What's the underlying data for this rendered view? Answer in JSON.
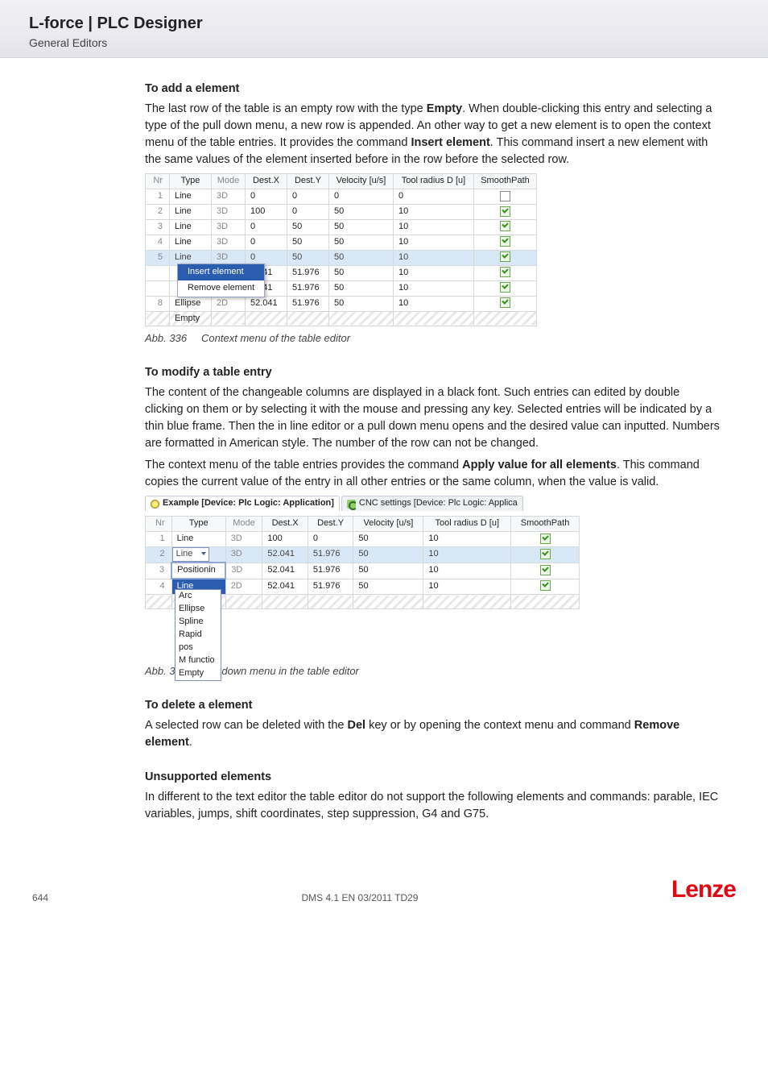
{
  "header": {
    "title": "L-force | PLC Designer",
    "subtitle": "General Editors"
  },
  "sec1": {
    "heading_prefix": "To add",
    "heading_rest": " a element",
    "p1a": "The last row of the table is an empty row with the type ",
    "p1b": "Empty",
    "p1c": ". When double-clicking this entry and selecting a type of the pull down menu, a new row is appended. An other way to get a new element is to open the context menu of the table entries. It provides the command ",
    "p1d": "Insert element",
    "p1e": ". This command insert a new element with the same values of the element inserted before in the row before the selected row."
  },
  "table1": {
    "cols": {
      "nr": "Nr",
      "type": "Type",
      "mode": "Mode",
      "dx": "Dest.X",
      "dy": "Dest.Y",
      "vel": "Velocity [u/s]",
      "tool": "Tool radius D [u]",
      "sp": "SmoothPath"
    },
    "rows": [
      {
        "nr": "1",
        "type": "Line",
        "mode": "3D",
        "dx": "0",
        "dy": "0",
        "vel": "0",
        "tool": "0",
        "sp": "empty"
      },
      {
        "nr": "2",
        "type": "Line",
        "mode": "3D",
        "dx": "100",
        "dy": "0",
        "vel": "50",
        "tool": "10",
        "sp": "checked"
      },
      {
        "nr": "3",
        "type": "Line",
        "mode": "3D",
        "dx": "0",
        "dy": "50",
        "vel": "50",
        "tool": "10",
        "sp": "checked"
      },
      {
        "nr": "4",
        "type": "Line",
        "mode": "3D",
        "dx": "0",
        "dy": "50",
        "vel": "50",
        "tool": "10",
        "sp": "checked"
      },
      {
        "nr": "5",
        "type": "Line",
        "mode": "3D",
        "dx": "0",
        "dy": "50",
        "vel": "50",
        "tool": "10",
        "sp": "checked",
        "selected": true
      },
      {
        "nr": "",
        "type": "",
        "mode": "",
        "dx": "2.041",
        "dy": "51.976",
        "vel": "50",
        "tool": "10",
        "sp": "checked"
      },
      {
        "nr": "",
        "type": "",
        "mode": "",
        "dx": "2.041",
        "dy": "51.976",
        "vel": "50",
        "tool": "10",
        "sp": "checked"
      },
      {
        "nr": "8",
        "type": "Ellipse",
        "mode": "2D",
        "dx": "52.041",
        "dy": "51.976",
        "vel": "50",
        "tool": "10",
        "sp": "checked"
      },
      {
        "nr": "",
        "type": "Empty",
        "mode": "",
        "dx": "",
        "dy": "",
        "vel": "",
        "tool": "",
        "sp": "",
        "hatched": true
      }
    ],
    "ctx": {
      "insert": "Insert element",
      "remove": "Remove element"
    }
  },
  "cap1": {
    "abb": "Abb. 336",
    "text": "Context menu of the table editor"
  },
  "sec2": {
    "heading": "To modify a table entry",
    "p1": "The content of the changeable columns are displayed in a black font. Such entries can edited by double clicking on them or by selecting it with the mouse and pressing any key.  Selected entries will be indicated by a thin blue frame. Then the in line editor or a pull down menu opens and the desired value can inputted. Numbers are formatted in American style. The number of the row can not be changed.",
    "p2a": "The context menu of the table entries provides the command ",
    "p2b": "Apply value for all elements",
    "p2c": ". This command copies the current value of the entry in all other entries or the same column, when the value is valid."
  },
  "tabs": {
    "left": "Example [Device: Plc Logic: Application]",
    "right": "CNC settings [Device: Plc Logic: Applica"
  },
  "table2": {
    "cols": {
      "nr": "Nr",
      "type": "Type",
      "mode": "Mode",
      "dx": "Dest.X",
      "dy": "Dest.Y",
      "vel": "Velocity [u/s]",
      "tool": "Tool radius D [u]",
      "sp": "SmoothPath"
    },
    "rows": [
      {
        "nr": "1",
        "type": "Line",
        "mode": "3D",
        "dx": "100",
        "dy": "0",
        "vel": "50",
        "tool": "10",
        "sp": "checked"
      },
      {
        "nr": "2",
        "type_dd": "Line",
        "mode": "3D",
        "dx": "52.041",
        "dy": "51.976",
        "vel": "50",
        "tool": "10",
        "sp": "checked",
        "selected_row": true
      },
      {
        "nr": "3",
        "type_sel": "Positionin",
        "mode": "3D",
        "dx": "52.041",
        "dy": "51.976",
        "vel": "50",
        "tool": "10",
        "sp": "checked"
      },
      {
        "nr": "4",
        "type_hl": "Line",
        "mode": "2D",
        "dx": "52.041",
        "dy": "51.976",
        "vel": "50",
        "tool": "10",
        "sp": "checked"
      },
      {
        "nr": "",
        "type": "",
        "mode": "",
        "dx": "",
        "dy": "",
        "vel": "",
        "tool": "",
        "sp": "",
        "hatched": true
      }
    ],
    "dropdown": [
      "Arc",
      "Ellipse",
      "Spline",
      "Rapid pos",
      "M functio",
      "Empty"
    ]
  },
  "cap2": {
    "abb": "Abb. 337",
    "text": "Pull down menu in the table editor"
  },
  "sec3": {
    "heading": "To delete a element",
    "p1a": "A selected row can be deleted with the  ",
    "p1b": "Del",
    "p1c": " key or by opening the context menu and command ",
    "p1d": "Remove element",
    "p1e": "."
  },
  "sec4": {
    "heading": "Unsupported elements",
    "p1": "In different to the text editor the table editor do not support the following elements and commands: parable, IEC variables, jumps, shift coordinates,  step suppression, G4 and G75."
  },
  "footer": {
    "page": "644",
    "doc": "DMS 4.1 EN 03/2011 TD29",
    "brand": "Lenze"
  }
}
